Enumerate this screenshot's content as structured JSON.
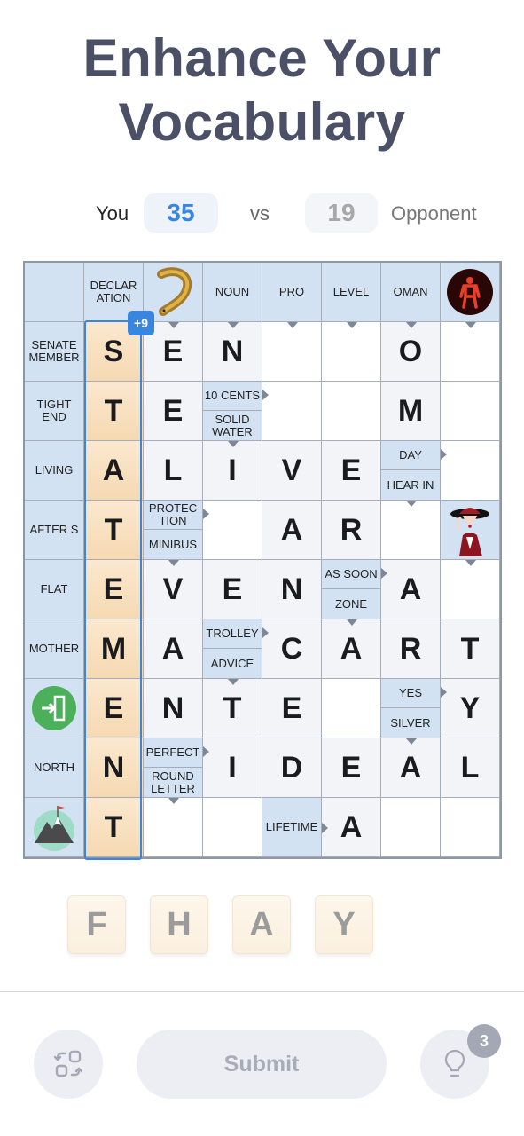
{
  "title": "Enhance Your Vocabulary",
  "score": {
    "you_label": "You",
    "you_value": "35",
    "vs": "vs",
    "opponent_value": "19",
    "opponent_label": "Opponent"
  },
  "colors": {
    "accent": "#3a86de",
    "title": "#4b5066",
    "clue_bg": "#d3e2f3",
    "tile_bg": "#f5d9b2"
  },
  "selected_word": {
    "word": "STATEMENT",
    "bonus": "+9"
  },
  "grid": {
    "cols": 8,
    "rows": [
      [
        {
          "t": "clue",
          "text": ""
        },
        {
          "t": "clue",
          "text": "DECLAR ATION"
        },
        {
          "t": "image",
          "icon": "eel-icon",
          "arrow": "down"
        },
        {
          "t": "clue",
          "text": "NOUN",
          "arrow": "down"
        },
        {
          "t": "clue",
          "text": "PRO",
          "arrow": "down"
        },
        {
          "t": "clue",
          "text": "LEVEL",
          "arrow": "down"
        },
        {
          "t": "clue",
          "text": "OMAN",
          "arrow": "down"
        },
        {
          "t": "image",
          "icon": "red-pedestrian-light-icon",
          "arrow": "down"
        }
      ],
      [
        {
          "t": "clue",
          "text": "SENATE MEMBER"
        },
        {
          "t": "tile",
          "l": "S"
        },
        {
          "t": "letter",
          "l": "E"
        },
        {
          "t": "letter",
          "l": "N"
        },
        {
          "t": "empty"
        },
        {
          "t": "empty"
        },
        {
          "t": "letter",
          "l": "O"
        },
        {
          "t": "empty"
        }
      ],
      [
        {
          "t": "clue",
          "text": "TIGHT END"
        },
        {
          "t": "tile",
          "l": "T"
        },
        {
          "t": "letter",
          "l": "E"
        },
        {
          "t": "split",
          "top": "10 CENTS",
          "bottom": "SOLID WATER",
          "arrow_top": "right",
          "arrow_bottom": "down"
        },
        {
          "t": "empty"
        },
        {
          "t": "empty"
        },
        {
          "t": "letter",
          "l": "M"
        },
        {
          "t": "empty"
        }
      ],
      [
        {
          "t": "clue",
          "text": "LIVING"
        },
        {
          "t": "tile",
          "l": "A"
        },
        {
          "t": "letter",
          "l": "L"
        },
        {
          "t": "letter",
          "l": "I"
        },
        {
          "t": "letter",
          "l": "V"
        },
        {
          "t": "letter",
          "l": "E"
        },
        {
          "t": "split",
          "top": "DAY",
          "bottom": "HEAR IN",
          "arrow_top": "right",
          "arrow_bottom": "down"
        },
        {
          "t": "empty"
        }
      ],
      [
        {
          "t": "clue",
          "text": "AFTER S"
        },
        {
          "t": "tile",
          "l": "T"
        },
        {
          "t": "split",
          "top": "PROTEC TION",
          "bottom": "MINIBUS",
          "arrow_top": "right",
          "arrow_bottom": "down"
        },
        {
          "t": "empty"
        },
        {
          "t": "letter",
          "l": "A"
        },
        {
          "t": "letter",
          "l": "R"
        },
        {
          "t": "empty"
        },
        {
          "t": "image",
          "icon": "woman-in-red-hat-icon",
          "arrow": "down"
        }
      ],
      [
        {
          "t": "clue",
          "text": "FLAT"
        },
        {
          "t": "tile",
          "l": "E"
        },
        {
          "t": "letter",
          "l": "V"
        },
        {
          "t": "letter",
          "l": "E"
        },
        {
          "t": "letter",
          "l": "N"
        },
        {
          "t": "split",
          "top": "AS SOON",
          "bottom": "ZONE",
          "arrow_top": "right",
          "arrow_bottom": "down"
        },
        {
          "t": "letter",
          "l": "A"
        },
        {
          "t": "empty"
        }
      ],
      [
        {
          "t": "clue",
          "text": "MOTHER"
        },
        {
          "t": "tile",
          "l": "M"
        },
        {
          "t": "letter",
          "l": "A"
        },
        {
          "t": "split",
          "top": "TROLLEY",
          "bottom": "ADVICE",
          "arrow_top": "right",
          "arrow_bottom": "down"
        },
        {
          "t": "letter",
          "l": "C"
        },
        {
          "t": "letter",
          "l": "A"
        },
        {
          "t": "letter",
          "l": "R"
        },
        {
          "t": "letter",
          "l": "T"
        }
      ],
      [
        {
          "t": "image",
          "icon": "exit-door-icon"
        },
        {
          "t": "tile",
          "l": "E"
        },
        {
          "t": "letter",
          "l": "N"
        },
        {
          "t": "letter",
          "l": "T"
        },
        {
          "t": "letter",
          "l": "E"
        },
        {
          "t": "empty"
        },
        {
          "t": "split",
          "top": "YES",
          "bottom": "SILVER",
          "arrow_top": "right",
          "arrow_bottom": "down"
        },
        {
          "t": "letter",
          "l": "Y"
        }
      ],
      [
        {
          "t": "clue",
          "text": "NORTH"
        },
        {
          "t": "tile",
          "l": "N"
        },
        {
          "t": "split",
          "top": "PERFECT",
          "bottom": "ROUND LETTER",
          "arrow_top": "right",
          "arrow_bottom": "down"
        },
        {
          "t": "letter",
          "l": "I"
        },
        {
          "t": "letter",
          "l": "D"
        },
        {
          "t": "letter",
          "l": "E"
        },
        {
          "t": "letter",
          "l": "A"
        },
        {
          "t": "letter",
          "l": "L"
        }
      ],
      [
        {
          "t": "image",
          "icon": "mountain-summit-icon"
        },
        {
          "t": "tile",
          "l": "T"
        },
        {
          "t": "empty"
        },
        {
          "t": "empty"
        },
        {
          "t": "clue",
          "text": "LIFETIME",
          "arrow": "right"
        },
        {
          "t": "letter",
          "l": "A"
        },
        {
          "t": "empty"
        },
        {
          "t": "empty"
        }
      ]
    ]
  },
  "rack": [
    "F",
    "H",
    "A",
    "Y"
  ],
  "controls": {
    "shuffle_icon": "shuffle-icon",
    "submit_label": "Submit",
    "hint_icon": "lightbulb-icon",
    "hint_count": "3"
  }
}
